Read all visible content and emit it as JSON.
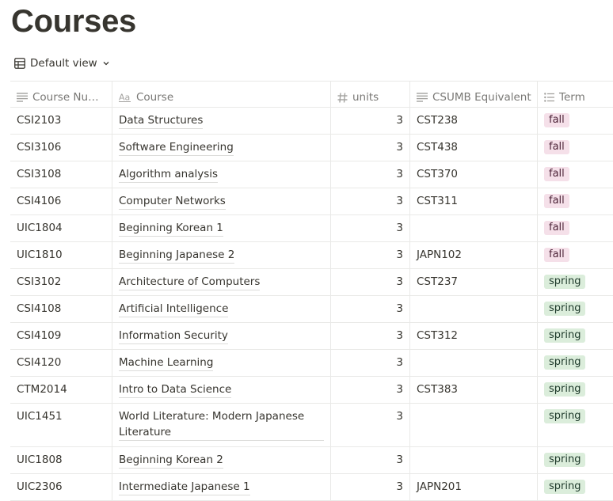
{
  "page": {
    "title": "Courses"
  },
  "view": {
    "label": "Default view"
  },
  "columns": [
    {
      "label": "Course Num...",
      "icon": "text-icon"
    },
    {
      "label": "Course",
      "icon": "title-icon"
    },
    {
      "label": "units",
      "icon": "number-icon"
    },
    {
      "label": "CSUMB Equivalent",
      "icon": "text-icon"
    },
    {
      "label": "Term",
      "icon": "select-icon"
    }
  ],
  "tag_colors": {
    "fall": {
      "bg": "#f5e0e9",
      "fg": "#4c2337"
    },
    "spring": {
      "bg": "#dbeddb",
      "fg": "#1c3829"
    }
  },
  "rows": [
    {
      "num": "CSI2103",
      "course": "Data Structures",
      "units": "3",
      "equiv": "CST238",
      "term": "fall"
    },
    {
      "num": "CSI3106",
      "course": "Software Engineering",
      "units": "3",
      "equiv": "CST438",
      "term": "fall"
    },
    {
      "num": "CSI3108",
      "course": "Algorithm analysis",
      "units": "3",
      "equiv": "CST370",
      "term": "fall"
    },
    {
      "num": "CSI4106",
      "course": "Computer Networks",
      "units": "3",
      "equiv": "CST311",
      "term": "fall"
    },
    {
      "num": "UIC1804",
      "course": "Beginning Korean 1",
      "units": "3",
      "equiv": "",
      "term": "fall"
    },
    {
      "num": "UIC1810",
      "course": "Beginning Japanese 2",
      "units": "3",
      "equiv": "JAPN102",
      "term": "fall"
    },
    {
      "num": "CSI3102",
      "course": "Architecture of Computers",
      "units": "3",
      "equiv": "CST237",
      "term": "spring"
    },
    {
      "num": "CSI4108",
      "course": "Artificial Intelligence",
      "units": "3",
      "equiv": "",
      "term": "spring"
    },
    {
      "num": "CSI4109",
      "course": "Information Security",
      "units": "3",
      "equiv": "CST312",
      "term": "spring"
    },
    {
      "num": "CSI4120",
      "course": "Machine Learning",
      "units": "3",
      "equiv": "",
      "term": "spring"
    },
    {
      "num": "CTM2014",
      "course": "Intro to Data Science",
      "units": "3",
      "equiv": "CST383",
      "term": "spring"
    },
    {
      "num": "UIC1451",
      "course": "World Literature: Modern Japanese Literature",
      "units": "3",
      "equiv": "",
      "term": "spring",
      "tall": true
    },
    {
      "num": "UIC1808",
      "course": "Beginning Korean 2",
      "units": "3",
      "equiv": "",
      "term": "spring"
    },
    {
      "num": "UIC2306",
      "course": "Intermediate Japanese 1",
      "units": "3",
      "equiv": "JAPN201",
      "term": "spring"
    }
  ]
}
